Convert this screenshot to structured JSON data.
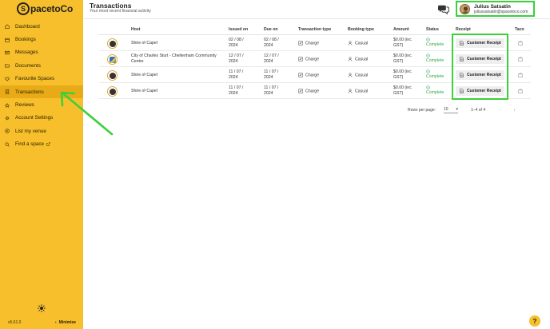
{
  "logo": {
    "mark": "S",
    "text": "pacetoCo"
  },
  "sidebar": {
    "items": [
      {
        "label": "Dashboard",
        "icon": "home-icon",
        "active": false
      },
      {
        "label": "Bookings",
        "icon": "calendar-icon",
        "active": false
      },
      {
        "label": "Messages",
        "icon": "mail-icon",
        "active": false
      },
      {
        "label": "Documents",
        "icon": "folder-icon",
        "active": false
      },
      {
        "label": "Favourite Spaces",
        "icon": "heart-icon",
        "active": false
      },
      {
        "label": "Transactions",
        "icon": "receipt-icon",
        "active": true
      },
      {
        "label": "Reviews",
        "icon": "star-icon",
        "active": false
      },
      {
        "label": "Account Settings",
        "icon": "gear-icon",
        "active": false
      },
      {
        "label": "List my venue",
        "icon": "plus-circle-icon",
        "active": false
      },
      {
        "label": "Find a space",
        "icon": "search-icon",
        "active": false,
        "external": true
      }
    ],
    "version": "v5.61.0",
    "minimise": "Minimise"
  },
  "header": {
    "title": "Transactions",
    "subtitle": "Your most recent financial activity",
    "user_name": "Julius Satsatin",
    "user_email": "juliussatsatin@spacetoco.com"
  },
  "table": {
    "columns": [
      "Host",
      "Issued on",
      "Due on",
      "Transaction type",
      "Booking type",
      "Amount",
      "Status",
      "Receipt",
      "Taco"
    ],
    "rows": [
      {
        "host": "Shire of Capel",
        "issued_1": "02 / 08 /",
        "issued_2": "2024",
        "due_1": "02 / 08 /",
        "due_2": "2024",
        "type": "Charge",
        "booking": "Casual",
        "amount_1": "$0.00 (inc",
        "amount_2": "GST)",
        "status": "Complete",
        "receipt": "Customer Receipt",
        "avatar": "dark"
      },
      {
        "host": "City of Charles Sturt - Cheltenham Community Centre",
        "issued_1": "12 / 07 /",
        "issued_2": "2024",
        "due_1": "12 / 07 /",
        "due_2": "2024",
        "type": "Charge",
        "booking": "Casual",
        "amount_1": "$0.00 (inc",
        "amount_2": "GST)",
        "status": "Complete",
        "receipt": "Customer Receipt",
        "avatar": "alt"
      },
      {
        "host": "Shire of Capel",
        "issued_1": "11 / 07 /",
        "issued_2": "2024",
        "due_1": "11 / 07 /",
        "due_2": "2024",
        "type": "Charge",
        "booking": "Casual",
        "amount_1": "$0.00 (inc",
        "amount_2": "GST)",
        "status": "Complete",
        "receipt": "Customer Receipt",
        "avatar": "dark"
      },
      {
        "host": "Shire of Capel",
        "issued_1": "11 / 07 /",
        "issued_2": "2024",
        "due_1": "11 / 07 /",
        "due_2": "2024",
        "type": "Charge",
        "booking": "Casual",
        "amount_1": "$0.00 (inc",
        "amount_2": "GST)",
        "status": "Complete",
        "receipt": "Customer Receipt",
        "avatar": "dark"
      }
    ]
  },
  "pagination": {
    "rows_per_page_label": "Rows per page:",
    "rows_per_page": "10",
    "range": "1–4 of 4",
    "prev": "‹",
    "next": "›"
  },
  "help": {
    "label": "?"
  },
  "colors": {
    "sidebar": "#f7bf2b",
    "sidebar_active": "#e8ab17",
    "highlight": "#3bd13b",
    "status_complete": "#2eaa4a"
  }
}
